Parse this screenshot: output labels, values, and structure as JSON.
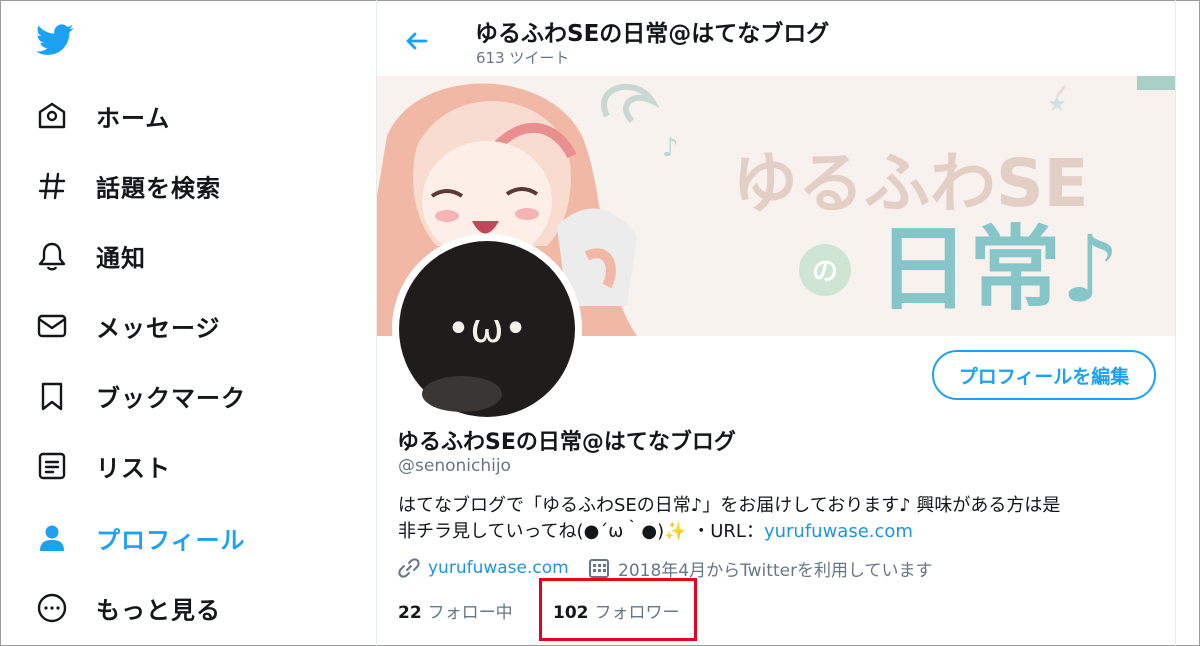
{
  "nav": {
    "items": [
      {
        "label": "ホーム",
        "icon": "home-icon"
      },
      {
        "label": "話題を検索",
        "icon": "hashtag-icon"
      },
      {
        "label": "通知",
        "icon": "bell-icon"
      },
      {
        "label": "メッセージ",
        "icon": "mail-icon"
      },
      {
        "label": "ブックマーク",
        "icon": "bookmark-icon"
      },
      {
        "label": "リスト",
        "icon": "list-icon"
      },
      {
        "label": "プロフィール",
        "icon": "person-icon",
        "active": true
      },
      {
        "label": "もっと見る",
        "icon": "more-icon"
      }
    ]
  },
  "header": {
    "title": "ゆるふわSEの日常@はてなブログ",
    "tweet_count": "613 ツイート"
  },
  "banner": {
    "title_line1": "ゆるふわSE",
    "title_mid": "の",
    "title_line2": "日常♪"
  },
  "avatar": {
    "face": "•ω•"
  },
  "profile": {
    "edit_button": "プロフィールを編集",
    "name": "ゆるふわSEの日常@はてなブログ",
    "handle": "@senonichijo",
    "bio_line1": "はてなブログで「ゆるふわSEの日常♪」をお届けしております♪ 興味がある方は是",
    "bio_line2_text": "非チラ見していってね(●´ω｀●)",
    "bio_sparkle": "✨",
    "bio_url_prefix": "・URL：",
    "bio_url": "yurufuwase.com",
    "website": "yurufuwase.com",
    "joined": "2018年4月からTwitterを利用しています",
    "following_count": "22",
    "following_label": "フォロー中",
    "followers_count": "102",
    "followers_label": "フォロワー"
  },
  "colors": {
    "accent": "#1da1f2",
    "highlight": "#e8001c",
    "muted": "#657786"
  }
}
